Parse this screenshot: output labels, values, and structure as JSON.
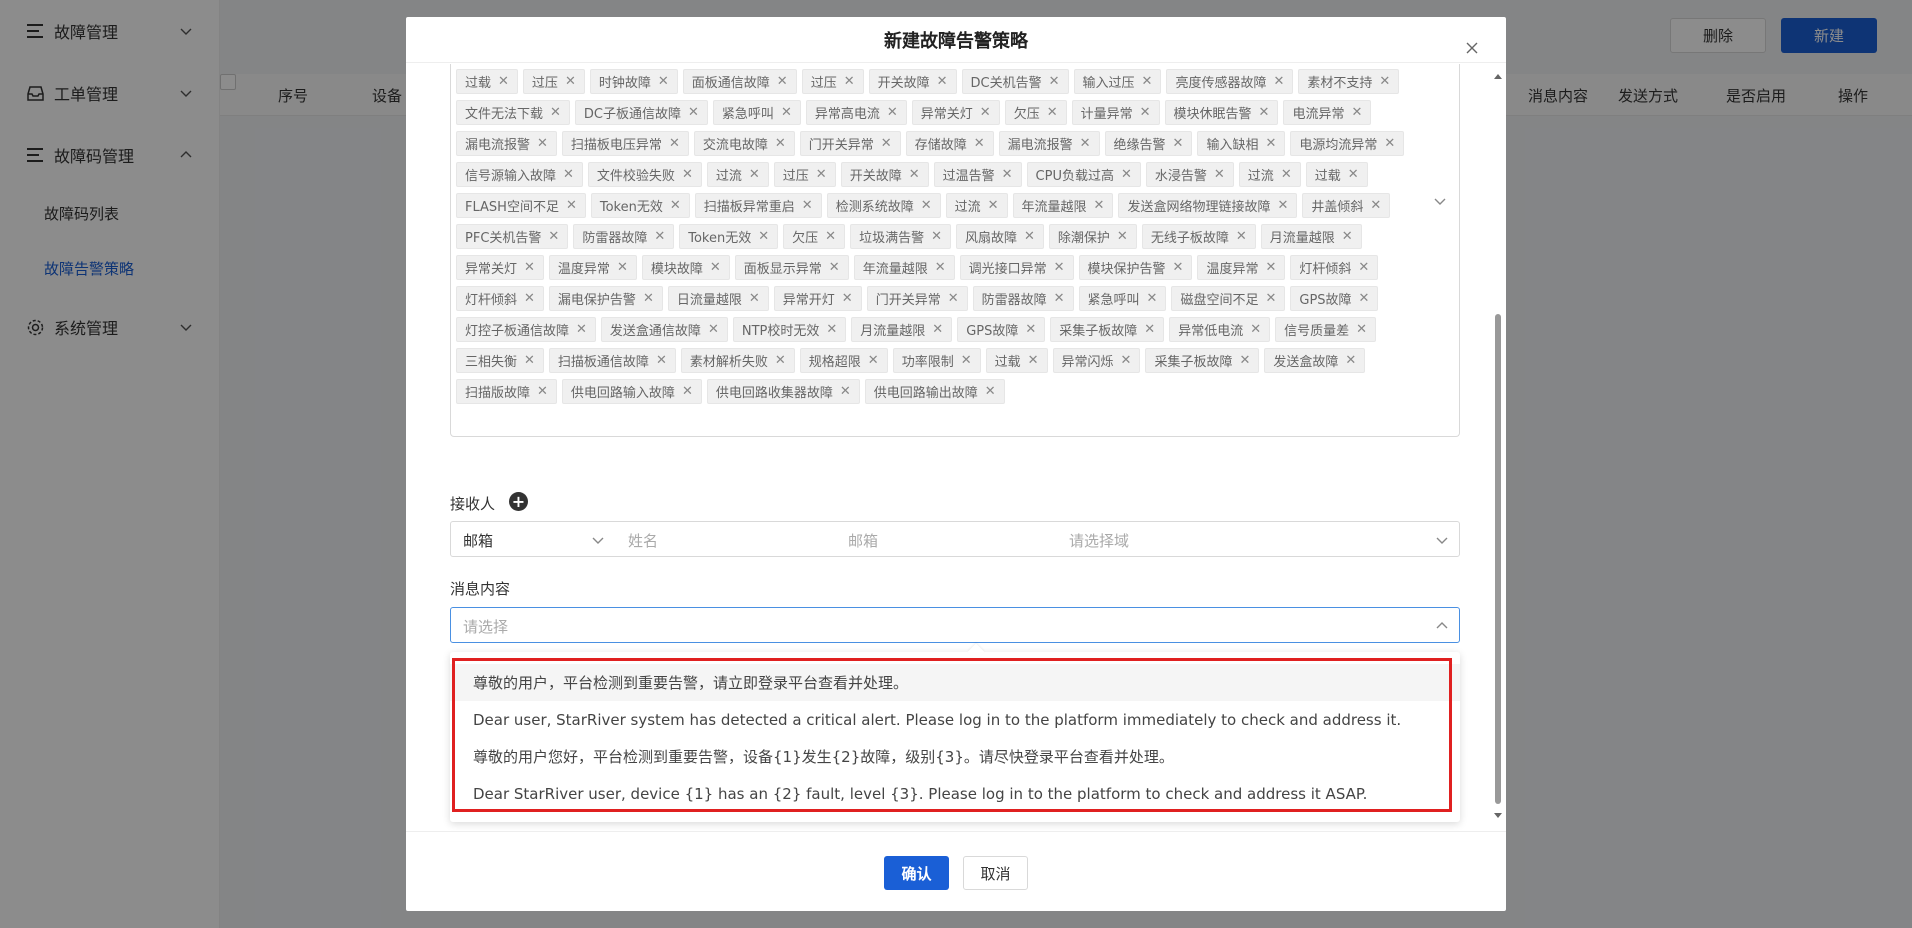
{
  "sidebar": {
    "groups": [
      {
        "label": "故障管理",
        "icon": "list-icon",
        "expanded": false
      },
      {
        "label": "工单管理",
        "icon": "inbox-icon",
        "expanded": false
      },
      {
        "label": "故障码管理",
        "icon": "list-icon",
        "expanded": true,
        "items": [
          {
            "label": "故障码列表",
            "active": false
          },
          {
            "label": "故障告警策略",
            "active": true
          }
        ]
      },
      {
        "label": "系统管理",
        "icon": "gear-icon",
        "expanded": false
      }
    ]
  },
  "toolbar": {
    "delete_label": "删除",
    "new_label": "新建"
  },
  "table": {
    "headers": [
      "序号",
      "设备",
      "消息内容",
      "发送方式",
      "是否启用",
      "操作"
    ]
  },
  "modal": {
    "title": "新建故障告警策略",
    "tags": [
      "过载",
      "过压",
      "时钟故障",
      "面板通信故障",
      "过压",
      "开关故障",
      "DC关机告警",
      "输入过压",
      "亮度传感器故障",
      "素材不支持",
      "文件无法下载",
      "DC子板通信故障",
      "紧急呼叫",
      "异常高电流",
      "异常关灯",
      "欠压",
      "计量异常",
      "模块休眠告警",
      "电流异常",
      "漏电流报警",
      "扫描板电压异常",
      "交流电故障",
      "门开关异常",
      "存储故障",
      "漏电流报警",
      "绝缘告警",
      "输入缺相",
      "电源均流异常",
      "信号源输入故障",
      "文件校验失败",
      "过流",
      "过压",
      "开关故障",
      "过温告警",
      "CPU负载过高",
      "水浸告警",
      "过流",
      "过载",
      "FLASH空间不足",
      "Token无效",
      "扫描板异常重启",
      "检测系统故障",
      "过流",
      "年流量越限",
      "发送盒网络物理链接故障",
      "井盖倾斜",
      "PFC关机告警",
      "防雷器故障",
      "Token无效",
      "欠压",
      "垃圾满告警",
      "风扇故障",
      "除潮保护",
      "无线子板故障",
      "月流量越限",
      "异常关灯",
      "温度异常",
      "模块故障",
      "面板显示异常",
      "年流量越限",
      "调光接口异常",
      "模块保护告警",
      "温度异常",
      "灯杆倾斜",
      "灯杆倾斜",
      "漏电保护告警",
      "日流量越限",
      "异常开灯",
      "门开关异常",
      "防雷器故障",
      "紧急呼叫",
      "磁盘空间不足",
      "GPS故障",
      "灯控子板通信故障",
      "发送盒通信故障",
      "NTP校时无效",
      "月流量越限",
      "GPS故障",
      "采集子板故障",
      "异常低电流",
      "信号质量差",
      "三相失衡",
      "扫描板通信故障",
      "素材解析失败",
      "规格超限",
      "功率限制",
      "过载",
      "异常闪烁",
      "采集子板故障",
      "发送盒故障",
      "扫描版故障",
      "供电回路输入故障",
      "供电回路收集器故障",
      "供电回路输出故障"
    ],
    "receiver_label": "接收人",
    "receiver": {
      "type": "邮箱",
      "name_placeholder": "姓名",
      "email_placeholder": "邮箱",
      "domain_placeholder": "请选择域"
    },
    "message_label": "消息内容",
    "message_placeholder": "请选择",
    "message_options": [
      "尊敬的用户，平台检测到重要告警，请立即登录平台查看并处理。",
      "Dear user, StarRiver system has detected a critical alert. Please log in to the platform immediately to check and address it.",
      "尊敬的用户您好，平台检测到重要告警，设备{1}发生{2}故障，级别{3}。请尽快登录平台查看并处理。",
      "Dear StarRiver user, device {1} has an {2} fault, level {3}. Please log in to the platform to check and address it ASAP."
    ],
    "ok_label": "确认",
    "cancel_label": "取消"
  },
  "colors": {
    "primary": "#1a5fd6",
    "highlight_frame": "#e02020"
  }
}
